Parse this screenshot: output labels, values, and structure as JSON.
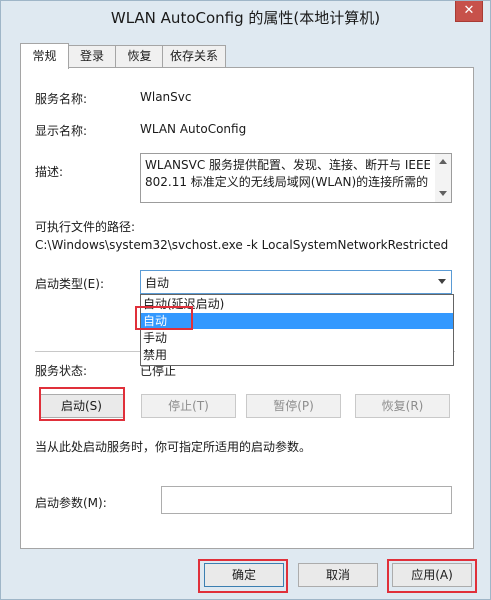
{
  "window": {
    "title": "WLAN AutoConfig 的属性(本地计算机)",
    "close_glyph": "✕"
  },
  "tabs": [
    {
      "label": "常规",
      "active": true
    },
    {
      "label": "登录",
      "active": false
    },
    {
      "label": "恢复",
      "active": false
    },
    {
      "label": "依存关系",
      "active": false
    }
  ],
  "general": {
    "service_name_label": "服务名称:",
    "service_name": "WlanSvc",
    "display_name_label": "显示名称:",
    "display_name": "WLAN AutoConfig",
    "description_label": "描述:",
    "description_lines": [
      "WLANSVC 服务提供配置、发现、连接、断开与 IEEE",
      "802.11 标准定义的无线局域网(WLAN)的连接所需的"
    ],
    "exe_path_label": "可执行文件的路径:",
    "exe_path": "C:\\Windows\\system32\\svchost.exe -k LocalSystemNetworkRestricted",
    "startup_type_label": "启动类型(E):",
    "startup_type_value": "自动",
    "startup_options": [
      {
        "label": "自动(延迟启动)",
        "selected": false
      },
      {
        "label": "自动",
        "selected": true
      },
      {
        "label": "手动",
        "selected": false
      },
      {
        "label": "禁用",
        "selected": false
      }
    ],
    "service_status_label": "服务状态:",
    "service_status": "已停止",
    "buttons": {
      "start": "启动(S)",
      "stop": "停止(T)",
      "pause": "暂停(P)",
      "resume": "恢复(R)"
    },
    "hint": "当从此处启动服务时，你可指定所适用的启动参数。",
    "start_params_label": "启动参数(M):",
    "start_params_value": ""
  },
  "footer": {
    "ok": "确定",
    "cancel": "取消",
    "apply": "应用(A)"
  },
  "colors": {
    "highlight": "#e0303a",
    "selection": "#3399ff",
    "close_button": "#c7514a"
  }
}
